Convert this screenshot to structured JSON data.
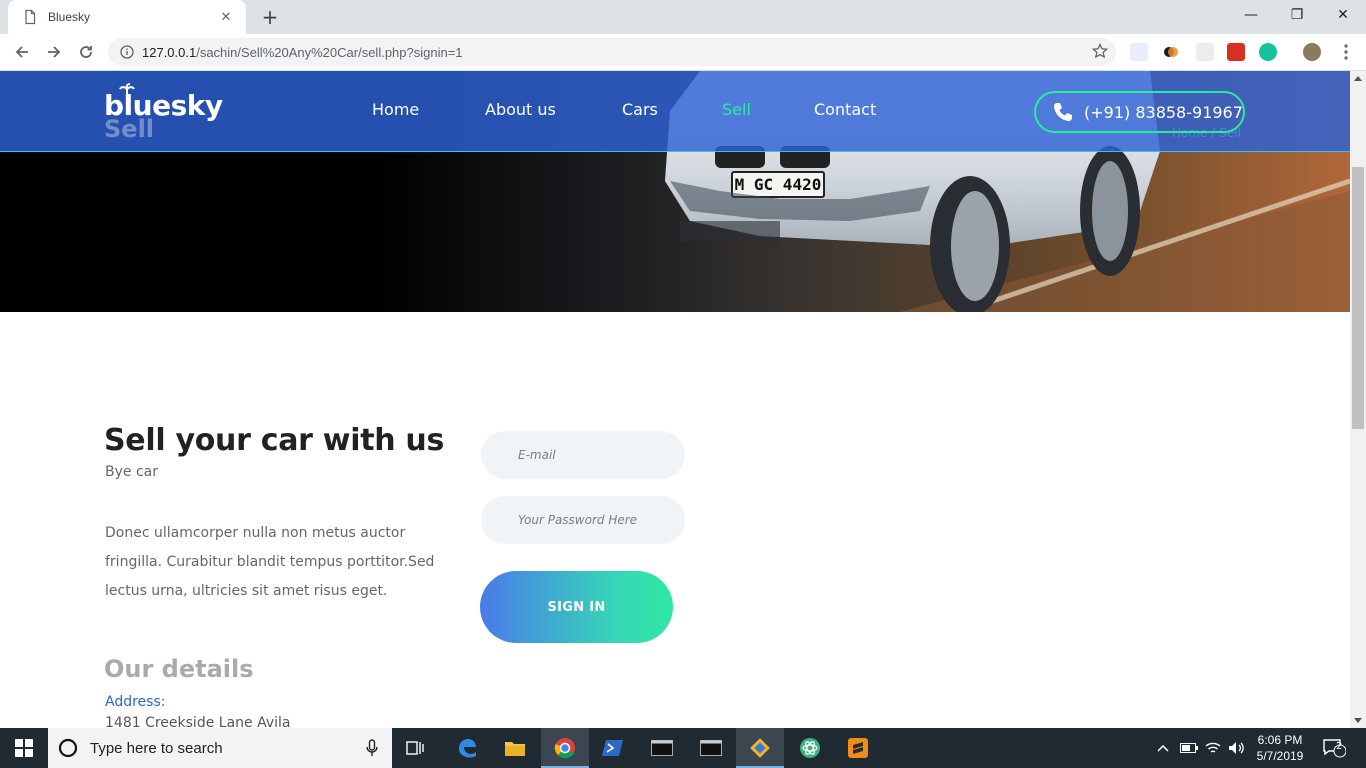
{
  "browser": {
    "tab_title": "Bluesky",
    "new_tab_label": "+",
    "url_host": "127.0.0.1",
    "url_path": "/sachin/Sell%20Any%20Car/sell.php?signin=1"
  },
  "site": {
    "logo": "bluesky",
    "logo_ghost": "Sell",
    "nav": [
      {
        "label": "Home"
      },
      {
        "label": "About us"
      },
      {
        "label": "Cars"
      },
      {
        "label": "Sell"
      },
      {
        "label": "Contact"
      }
    ],
    "active_nav": "Sell",
    "phone": "(+91) 83858-91967",
    "breadcrumb_ghost": "Home / Sell",
    "plate": "M GC 4420",
    "accent": "#2ee8a2",
    "brand_blue": "#2e62d6"
  },
  "content": {
    "title": "Sell your car with us",
    "subtitle": "Bye car",
    "body": "Donec ullamcorper nulla non metus auctor fringilla. Curabitur blandit tempus porttitor.Sed lectus urna, ultricies sit amet risus eget.",
    "details_title": "Our details",
    "address_label": "Address:",
    "address_line": "1481 Creekside Lane Avila"
  },
  "form": {
    "email_placeholder": "E-mail",
    "password_placeholder": "Your Password Here",
    "signin_label": "SIGN IN"
  },
  "taskbar": {
    "search_placeholder": "Type here to search",
    "time": "6:06 PM",
    "date": "5/7/2019",
    "notification_count": "2"
  }
}
